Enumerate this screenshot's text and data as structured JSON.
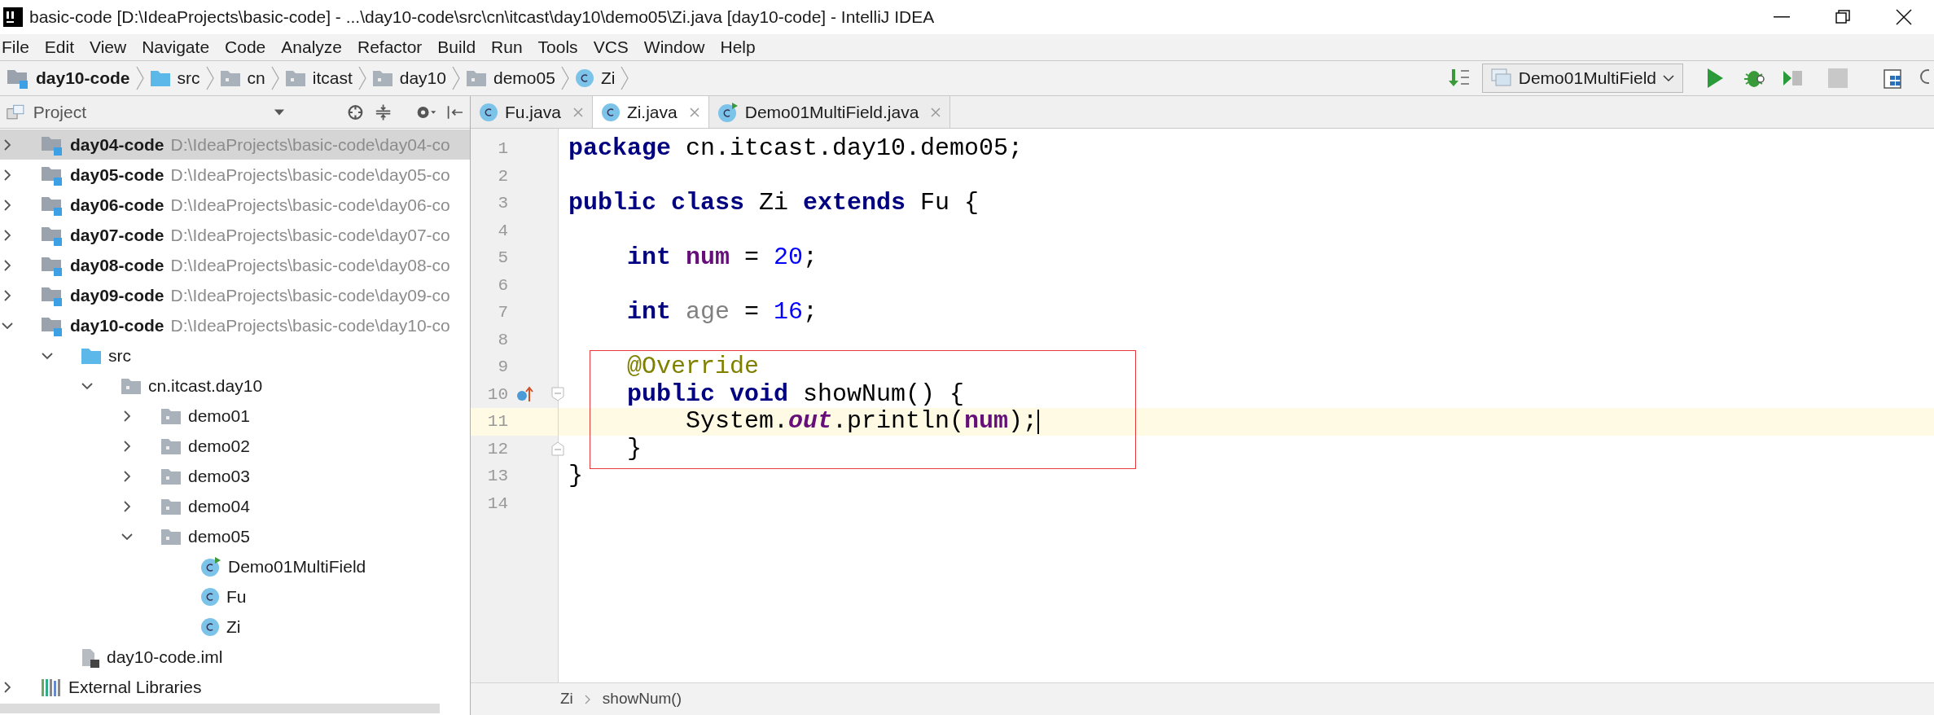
{
  "window": {
    "title": "basic-code [D:\\IdeaProjects\\basic-code] - ...\\day10-code\\src\\cn\\itcast\\day10\\demo05\\Zi.java [day10-code] - IntelliJ IDEA"
  },
  "menu": [
    "File",
    "Edit",
    "View",
    "Navigate",
    "Code",
    "Analyze",
    "Refactor",
    "Build",
    "Run",
    "Tools",
    "VCS",
    "Window",
    "Help"
  ],
  "navigation_bar": [
    {
      "label": "day10-code",
      "kind": "module"
    },
    {
      "label": "src",
      "kind": "source"
    },
    {
      "label": "cn",
      "kind": "package"
    },
    {
      "label": "itcast",
      "kind": "package"
    },
    {
      "label": "day10",
      "kind": "package"
    },
    {
      "label": "demo05",
      "kind": "package"
    },
    {
      "label": "Zi",
      "kind": "class"
    }
  ],
  "run_configuration": "Demo01MultiField",
  "project_panel": {
    "title": "Project",
    "tree": [
      {
        "name": "day04-code",
        "path": "D:\\IdeaProjects\\basic-code\\day04-co",
        "kind": "module",
        "expanded": false,
        "selected": true
      },
      {
        "name": "day05-code",
        "path": "D:\\IdeaProjects\\basic-code\\day05-co",
        "kind": "module",
        "expanded": false,
        "selected": false
      },
      {
        "name": "day06-code",
        "path": "D:\\IdeaProjects\\basic-code\\day06-co",
        "kind": "module",
        "expanded": false,
        "selected": false
      },
      {
        "name": "day07-code",
        "path": "D:\\IdeaProjects\\basic-code\\day07-co",
        "kind": "module",
        "expanded": false,
        "selected": false
      },
      {
        "name": "day08-code",
        "path": "D:\\IdeaProjects\\basic-code\\day08-co",
        "kind": "module",
        "expanded": false,
        "selected": false
      },
      {
        "name": "day09-code",
        "path": "D:\\IdeaProjects\\basic-code\\day09-co",
        "kind": "module",
        "expanded": false,
        "selected": false
      },
      {
        "name": "day10-code",
        "path": "D:\\IdeaProjects\\basic-code\\day10-co",
        "kind": "module",
        "expanded": true,
        "selected": false,
        "children": [
          {
            "name": "src",
            "kind": "source",
            "expanded": true,
            "selected": false,
            "children": [
              {
                "name": "cn.itcast.day10",
                "kind": "package",
                "expanded": true,
                "selected": false,
                "children": [
                  {
                    "name": "demo01",
                    "kind": "package",
                    "expanded": false,
                    "selected": false
                  },
                  {
                    "name": "demo02",
                    "kind": "package",
                    "expanded": false,
                    "selected": false
                  },
                  {
                    "name": "demo03",
                    "kind": "package",
                    "expanded": false,
                    "selected": false
                  },
                  {
                    "name": "demo04",
                    "kind": "package",
                    "expanded": false,
                    "selected": false
                  },
                  {
                    "name": "demo05",
                    "kind": "package",
                    "expanded": true,
                    "selected": false,
                    "children": [
                      {
                        "name": "Demo01MultiField",
                        "kind": "main_class",
                        "selected": false
                      },
                      {
                        "name": "Fu",
                        "kind": "class",
                        "selected": false
                      },
                      {
                        "name": "Zi",
                        "kind": "class",
                        "selected": false
                      }
                    ]
                  }
                ]
              }
            ]
          },
          {
            "name": "day10-code.iml",
            "kind": "iml",
            "selected": false
          }
        ]
      },
      {
        "name": "External Libraries",
        "kind": "libraries",
        "expanded": false,
        "selected": false
      }
    ]
  },
  "tabs": [
    {
      "label": "Fu.java",
      "kind": "class",
      "selected": false
    },
    {
      "label": "Zi.java",
      "kind": "class",
      "selected": true
    },
    {
      "label": "Demo01MultiField.java",
      "kind": "main_class",
      "selected": false
    }
  ],
  "editor": {
    "lines": [
      {
        "number": "1",
        "tokens": [
          {
            "t": "package",
            "kind": "keyword"
          },
          {
            "t": " cn.itcast.day10.demo05;",
            "kind": "plain"
          }
        ]
      },
      {
        "number": "2"
      },
      {
        "number": "3",
        "tokens": [
          {
            "t": "public class",
            "kind": "keyword"
          },
          {
            "t": " Zi ",
            "kind": "plain"
          },
          {
            "t": "extends",
            "kind": "keyword"
          },
          {
            "t": " Fu {",
            "kind": "plain"
          }
        ]
      },
      {
        "number": "4"
      },
      {
        "number": "5",
        "tokens": [
          {
            "t": "    int",
            "kind": "keyword"
          },
          {
            "t": " num",
            "kind": "field"
          },
          {
            "t": " = ",
            "kind": "plain"
          },
          {
            "t": "20",
            "kind": "number"
          },
          {
            "t": ";",
            "kind": "plain"
          }
        ]
      },
      {
        "number": "6"
      },
      {
        "number": "7",
        "tokens": [
          {
            "t": "    int",
            "kind": "keyword"
          },
          {
            "t": " age",
            "kind": "unused"
          },
          {
            "t": " = ",
            "kind": "plain"
          },
          {
            "t": "16",
            "kind": "number"
          },
          {
            "t": ";",
            "kind": "plain"
          }
        ]
      },
      {
        "number": "8"
      },
      {
        "number": "9",
        "boxed": true,
        "tokens": [
          {
            "t": "    @Override",
            "kind": "annotation"
          }
        ]
      },
      {
        "number": "10",
        "boxed": true,
        "gutter_marker": {
          "kind": "override"
        },
        "fold_marker": {
          "kind": "start"
        },
        "tokens": [
          {
            "t": "    public void",
            "kind": "keyword"
          },
          {
            "t": " showNum() {",
            "kind": "plain"
          }
        ]
      },
      {
        "number": "11",
        "boxed": true,
        "current": true,
        "caret": true,
        "tokens": [
          {
            "t": "        System.",
            "kind": "plain"
          },
          {
            "t": "out",
            "kind": "static"
          },
          {
            "t": ".println(",
            "kind": "plain"
          },
          {
            "t": "num",
            "kind": "field"
          },
          {
            "t": ");",
            "kind": "plain"
          }
        ]
      },
      {
        "number": "12",
        "boxed": true,
        "fold_marker": {
          "kind": "end"
        },
        "tokens": [
          {
            "t": "    }",
            "kind": "plain"
          }
        ]
      },
      {
        "number": "13",
        "tokens": [
          {
            "t": "}",
            "kind": "plain"
          }
        ]
      },
      {
        "number": "14"
      }
    ],
    "breadcrumbs": [
      "Zi",
      "showNum()"
    ]
  }
}
